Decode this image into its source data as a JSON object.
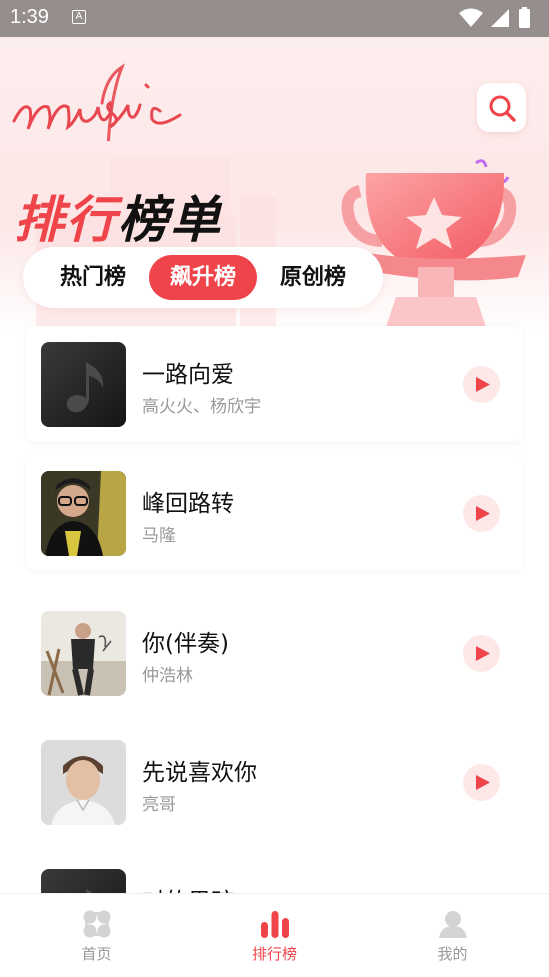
{
  "status_bar": {
    "time": "1:39",
    "notification_glyph": "A"
  },
  "header": {
    "logo_text": "music",
    "title_part1": "排行",
    "title_part2": "榜单"
  },
  "tabs": [
    {
      "label": "热门榜",
      "active": false
    },
    {
      "label": "飙升榜",
      "active": true
    },
    {
      "label": "原创榜",
      "active": false
    }
  ],
  "songs": [
    {
      "title": "一路向爱",
      "artist": "高火火、杨欣宇",
      "cover": "music-note-placeholder"
    },
    {
      "title": "峰回路转",
      "artist": "马隆",
      "cover": "album-photo-male-glasses"
    },
    {
      "title": "你(伴奏)",
      "artist": "仲浩林",
      "cover": "album-photo-male-standing"
    },
    {
      "title": "先说喜欢你",
      "artist": "亮哥",
      "cover": "album-photo-male-portrait"
    },
    {
      "title": "对的男孩",
      "artist": "",
      "cover": "music-note-placeholder"
    }
  ],
  "bottom_nav": [
    {
      "label": "首页",
      "icon": "home-grid-icon",
      "active": false
    },
    {
      "label": "排行榜",
      "icon": "chart-bars-icon",
      "active": true
    },
    {
      "label": "我的",
      "icon": "profile-icon",
      "active": false
    }
  ],
  "colors": {
    "accent": "#f0444b",
    "accent_light": "#fde7e7",
    "status_bar": "#968d8d"
  }
}
